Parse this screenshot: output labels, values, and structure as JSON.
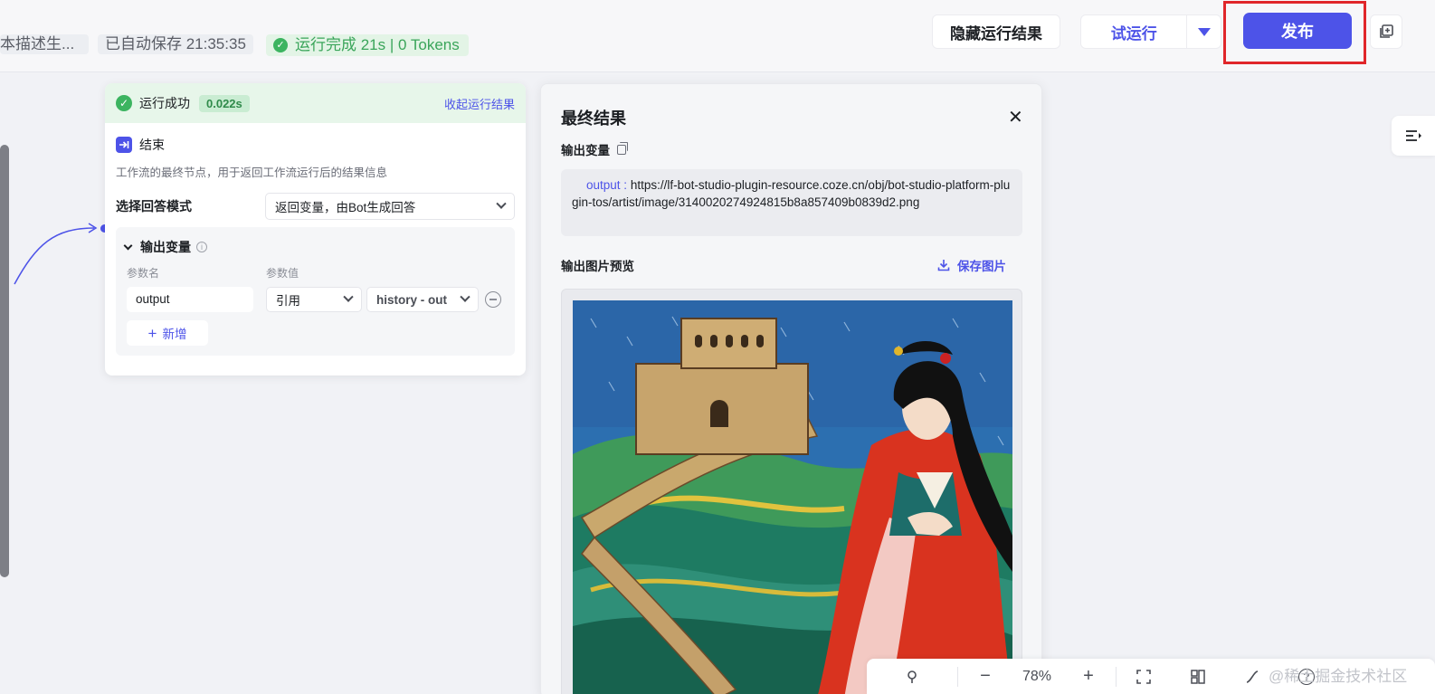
{
  "topbar": {
    "workflow_desc": "本描述生...",
    "autosave": "已自动保存 21:35:35",
    "run_status": "运行完成 21s | 0 Tokens",
    "hide_results_label": "隐藏运行结果",
    "trial_run_label": "试运行",
    "publish_label": "发布"
  },
  "end_node": {
    "status": "运行成功",
    "elapsed": "0.022s",
    "collapse_label": "收起运行结果",
    "title": "结束",
    "description": "工作流的最终节点，用于返回工作流运行后的结果信息",
    "answer_mode_label": "选择回答模式",
    "answer_mode_value": "返回变量，由Bot生成回答",
    "output_section_label": "输出变量",
    "col_param_name": "参数名",
    "col_param_value": "参数值",
    "param_name": "output",
    "ref_type": "引用",
    "ref_value": "history - out",
    "add_label": "新增"
  },
  "result_panel": {
    "title": "最终结果",
    "output_var_label": "输出变量",
    "output_key": "output",
    "output_url": "https://lf-bot-studio-plugin-resource.coze.cn/obj/bot-studio-platform-plugin-tos/artist/image/3140020274924815b8a857409b0839d2.png",
    "preview_label": "输出图片预览",
    "save_image_label": "保存图片"
  },
  "bottom_toolbar": {
    "zoom": "78%"
  },
  "watermark": "@稀土掘金技术社区",
  "colors": {
    "accent": "#4d53e8",
    "success": "#3cb460",
    "highlight_frame": "#e0262a"
  },
  "icons": [
    "check-circle-icon",
    "caret-down-icon",
    "copy-icon",
    "end-node-icon",
    "chevron-down-icon",
    "info-icon",
    "minus-circle-icon",
    "plus-icon",
    "close-icon",
    "download-icon",
    "zoom-out-icon",
    "zoom-in-icon",
    "fit-view-icon",
    "layout-icon",
    "help-icon",
    "panel-toggle-icon"
  ]
}
